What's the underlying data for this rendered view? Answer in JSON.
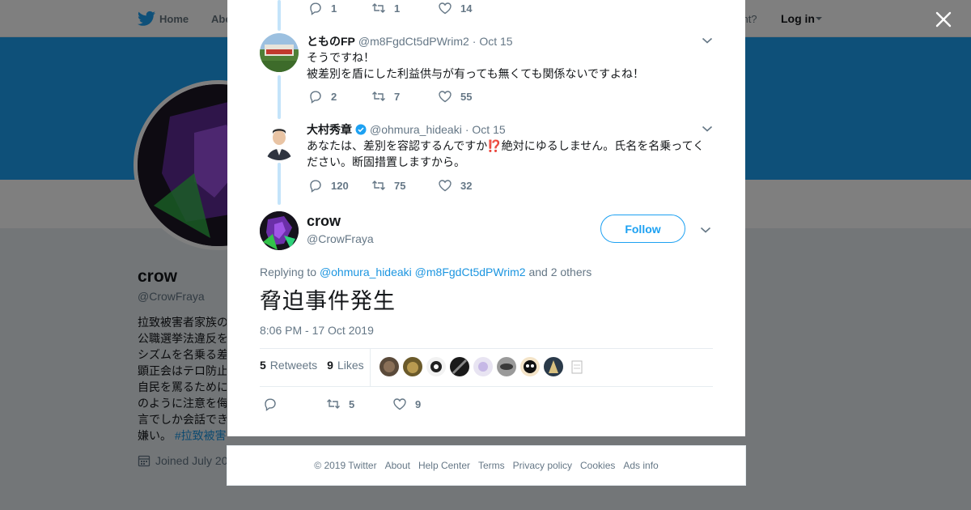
{
  "nav": {
    "home": "Home",
    "about": "Abo",
    "account_prompt": "ccount?",
    "login": "Log in"
  },
  "profile": {
    "name": "crow",
    "handle": "@CrowFraya",
    "bio_lines": [
      "拉致被害者家族の",
      "公職選挙法違反を",
      "シズムを名乗る差",
      "顕正会はテロ防止",
      "自民を罵るために",
      "のように注意を侮",
      "言でしか会話でき"
    ],
    "bio_last": "嫌い。",
    "bio_hashtag": "#拉致被害",
    "joined": "Joined July 20"
  },
  "thread": {
    "top_actions": {
      "replies": "1",
      "retweets": "1",
      "likes": "14"
    },
    "replies": [
      {
        "name": "とものFP",
        "handle": "@m8FgdCt5dPWrim2",
        "date": "· Oct 15",
        "lines": [
          "そうですね！",
          "被差別を盾にした利益供与が有っても無くても関係ないですよね！"
        ],
        "replies": "2",
        "retweets": "7",
        "likes": "55"
      },
      {
        "name": "大村秀章",
        "handle": "@ohmura_hideaki",
        "date": "· Oct 15",
        "lines": [
          "あなたは、差別を容認するんですか⁉️絶対にゆるしません。氏名を名乗ってく",
          "ださい。断固措置しますから。"
        ],
        "replies": "120",
        "retweets": "75",
        "likes": "32"
      }
    ]
  },
  "tweet": {
    "name": "crow",
    "handle": "@CrowFraya",
    "follow": "Follow",
    "replying_prefix": "Replying to",
    "replying_to_1": "@ohmura_hideaki",
    "replying_to_2": "@m8FgdCt5dPWrim2",
    "replying_suffix": "and 2 others",
    "text": "脅迫事件発生",
    "date": "8:06 PM - 17 Oct 2019",
    "retweet_count": "5",
    "retweet_label": "Retweets",
    "like_count": "9",
    "like_label": "Likes",
    "action_retweets": "5",
    "action_likes": "9"
  },
  "footer": {
    "copyright": "© 2019 Twitter",
    "about": "About",
    "help": "Help Center",
    "terms": "Terms",
    "privacy": "Privacy policy",
    "cookies": "Cookies",
    "ads": "Ads info"
  },
  "colors": {
    "accent": "#1da1f2",
    "link": "#1b95e0",
    "muted": "#657786",
    "banner": "#1da1f2"
  }
}
